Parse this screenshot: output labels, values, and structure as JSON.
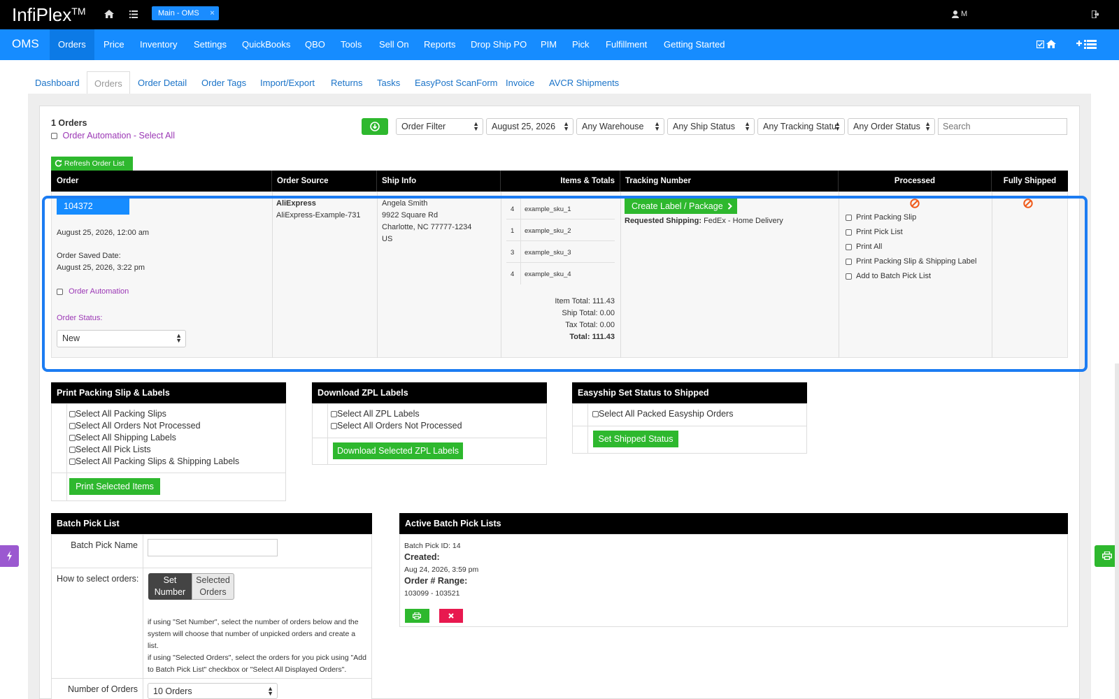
{
  "topbar": {
    "brand": "InfiPlex",
    "brand_tm": "TM",
    "tab_label": "Main - OMS",
    "tab_close": "×",
    "user_label": "M"
  },
  "nav": {
    "brand": "OMS",
    "items": [
      "Orders",
      "Price",
      "Inventory",
      "Settings",
      "QuickBooks",
      "QBO",
      "Tools",
      "Sell On",
      "Reports",
      "Drop Ship PO",
      "PIM",
      "Pick",
      "Fulfillment",
      "Getting Started"
    ]
  },
  "subtabs": [
    "Dashboard",
    "Orders",
    "Order Detail",
    "Order Tags",
    "Import/Export",
    "Returns",
    "Tasks",
    "EasyPost ScanForm",
    "Invoice",
    "AVCR Shipments"
  ],
  "filters": {
    "order_count": "1 Orders",
    "automation_select_all": "Order Automation - Select All",
    "order_filter": "Order Filter",
    "date": "August 25, 2026",
    "warehouse": "Any Warehouse",
    "ship_status": "Any Ship Status",
    "tracking_status": "Any Tracking Statu",
    "order_status": "Any Order Status",
    "search_placeholder": "Search",
    "refresh_label": "Refresh Order List"
  },
  "table": {
    "headers": [
      "Order",
      "Order Source",
      "Ship Info",
      "Items & Totals",
      "Tracking Number",
      "Processed",
      "Fully Shipped"
    ]
  },
  "order": {
    "id": "104372",
    "date": "August 25, 2026, 12:00 am",
    "saved_label": "Order Saved Date:",
    "saved_date": "August 25, 2026, 3:22 pm",
    "automation_label": "Order Automation",
    "status_label": "Order Status:",
    "status_value": "New",
    "source_name": "AliExpress",
    "source_id": "AliExpress-Example-731",
    "ship_name": "Angela Smith",
    "ship_street": "9922 Square Rd",
    "ship_city": "Charlotte, NC 77777-1234",
    "ship_country": "US",
    "items": [
      {
        "qty": "4",
        "sku": "example_sku_1"
      },
      {
        "qty": "1",
        "sku": "example_sku_2"
      },
      {
        "qty": "3",
        "sku": "example_sku_3"
      },
      {
        "qty": "4",
        "sku": "example_sku_4"
      }
    ],
    "item_total": "Item Total: 111.43",
    "ship_total": "Ship Total: 0.00",
    "tax_total": "Tax Total: 0.00",
    "total": "Total: 111.43",
    "create_label": "Create Label / Package",
    "requested_shipping_label": "Requested Shipping:",
    "requested_shipping_value": "FedEx - Home Delivery",
    "process_options": [
      "Print Packing Slip",
      "Print Pick List",
      "Print All",
      "Print Packing Slip & Shipping Label",
      "Add to Batch Pick List"
    ]
  },
  "print_box": {
    "title": "Print Packing Slip & Labels",
    "options": [
      "Select All Packing Slips",
      "Select All Orders Not Processed",
      "Select All Shipping Labels",
      "Select All Pick Lists",
      "Select All Packing Slips & Shipping Labels"
    ],
    "button": "Print Selected Items"
  },
  "zpl_box": {
    "title": "Download ZPL Labels",
    "options": [
      "Select All ZPL Labels",
      "Select All Orders Not Processed"
    ],
    "button": "Download Selected ZPL Labels"
  },
  "easyship_box": {
    "title": "Easyship Set Status to Shipped",
    "option": "Select All Packed Easyship Orders",
    "button": "Set Shipped Status"
  },
  "batch": {
    "title": "Batch Pick List",
    "name_label": "Batch Pick Name",
    "how_label": "How to select orders:",
    "set_number_1": "Set",
    "set_number_2": "Number",
    "selected_1": "Selected",
    "selected_2": "Orders",
    "help_1": "if using \"Set Number\", select the number of orders below and the",
    "help_2": "system will choose that number of unpicked orders and create a",
    "help_3": "list.",
    "help_4": "if using \"Selected Orders\", select the orders for you pick using \"Add",
    "help_5": "to Batch Pick List\" checkbox or \"Select All Displayed Orders\".",
    "num_label": "Number of Orders",
    "num_value": "10 Orders"
  },
  "active_batch": {
    "title": "Active Batch Pick Lists",
    "id": "Batch Pick ID: 14",
    "created_label": "Created:",
    "created_value": "Aug 24, 2026, 3:59 pm",
    "range_label": "Order # Range:",
    "range_value": "103099 - 103521"
  },
  "colors": {
    "nav_blue": "#168cff",
    "green": "#2eb82e",
    "highlight": "#1c7cf2",
    "danger": "#e8194f",
    "purple_side": "#9b59d0"
  }
}
